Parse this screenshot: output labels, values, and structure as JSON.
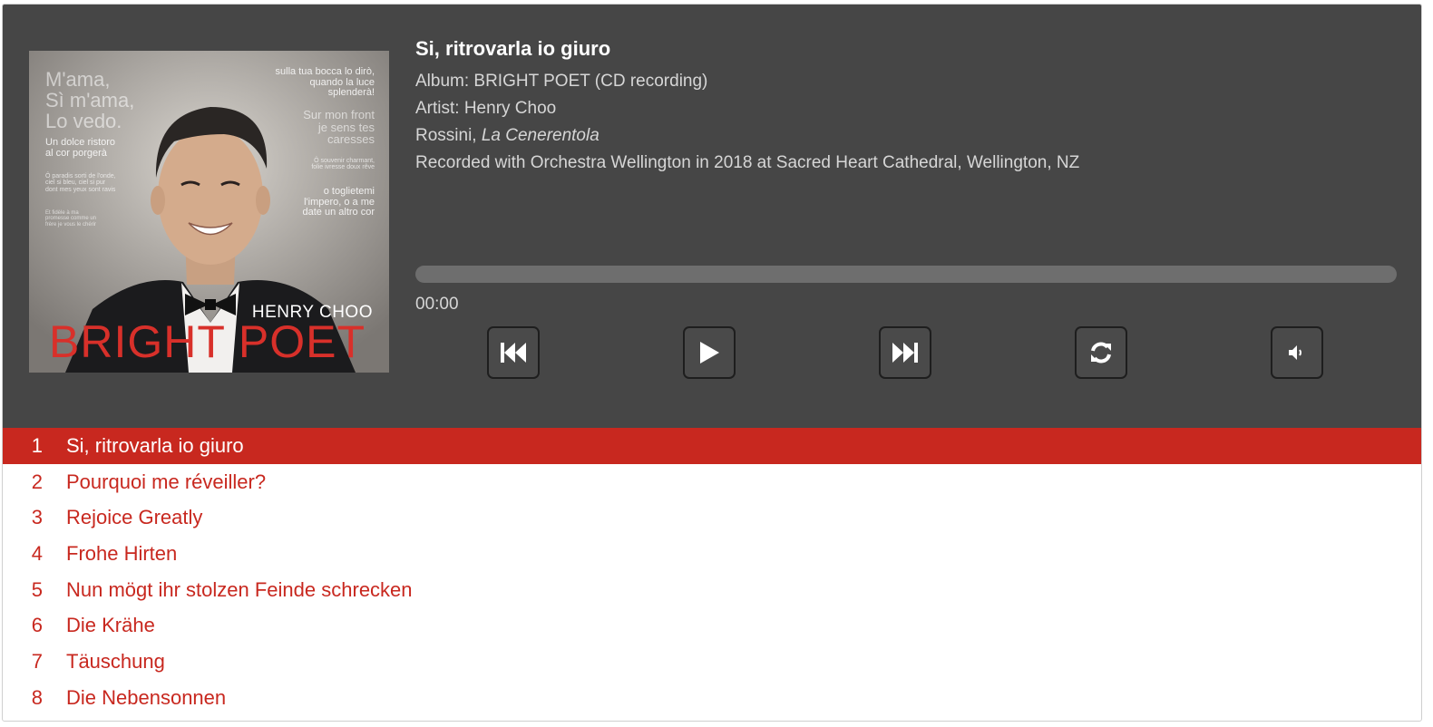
{
  "now_playing": {
    "title": "Si, ritrovarla io giuro",
    "album_line": "Album: BRIGHT POET (CD recording)",
    "artist_line": "Artist: Henry Choo",
    "composer": "Rossini, ",
    "work": "La Cenerentola",
    "recorded_line": "Recorded with Orchestra Wellington in 2018 at Sacred Heart Cathedral, Wellington, NZ",
    "time": "00:00",
    "progress_fraction": 0
  },
  "cover": {
    "artist": "HENRY CHOO",
    "title": "BRIGHT POET",
    "text_left_1": "M'ama,\nSì m'ama,\nLo vedo.",
    "text_left_2": "Un dolce ristoro\nal cor porgerà",
    "text_left_3": "Ô paradis sorti de l'onde,\nciel si bleu, ciel si pur\ndont mes yeux sont ravis",
    "text_left_4": "Et fidèle à ma\npromesse comme un\nfrère je vous le chérir",
    "text_right_1": "sulla tua bocca lo dirò,\nquando la luce\nsplenderà!",
    "text_right_2": "Sur mon front\nje sens tes\ncaresses",
    "text_right_3": "Ô souvenir charmant,\nfolie ivresse doux rêve",
    "text_right_4": "o toglietemi\nl'impero, o a me\ndate un altro cor"
  },
  "controls": {
    "prev_icon": "skip-back-icon",
    "play_icon": "play-icon",
    "next_icon": "skip-forward-icon",
    "repeat_icon": "repeat-icon",
    "volume_icon": "volume-icon"
  },
  "colors": {
    "accent": "#c8281f",
    "panel": "#464646"
  },
  "playlist": [
    {
      "num": "1",
      "title": "Si, ritrovarla io giuro",
      "active": true
    },
    {
      "num": "2",
      "title": "Pourquoi me réveiller?",
      "active": false
    },
    {
      "num": "3",
      "title": "Rejoice Greatly",
      "active": false
    },
    {
      "num": "4",
      "title": "Frohe Hirten",
      "active": false
    },
    {
      "num": "5",
      "title": "Nun mögt ihr stolzen Feinde schrecken",
      "active": false
    },
    {
      "num": "6",
      "title": "Die Krähe",
      "active": false
    },
    {
      "num": "7",
      "title": "Täuschung",
      "active": false
    },
    {
      "num": "8",
      "title": "Die Nebensonnen",
      "active": false
    }
  ]
}
